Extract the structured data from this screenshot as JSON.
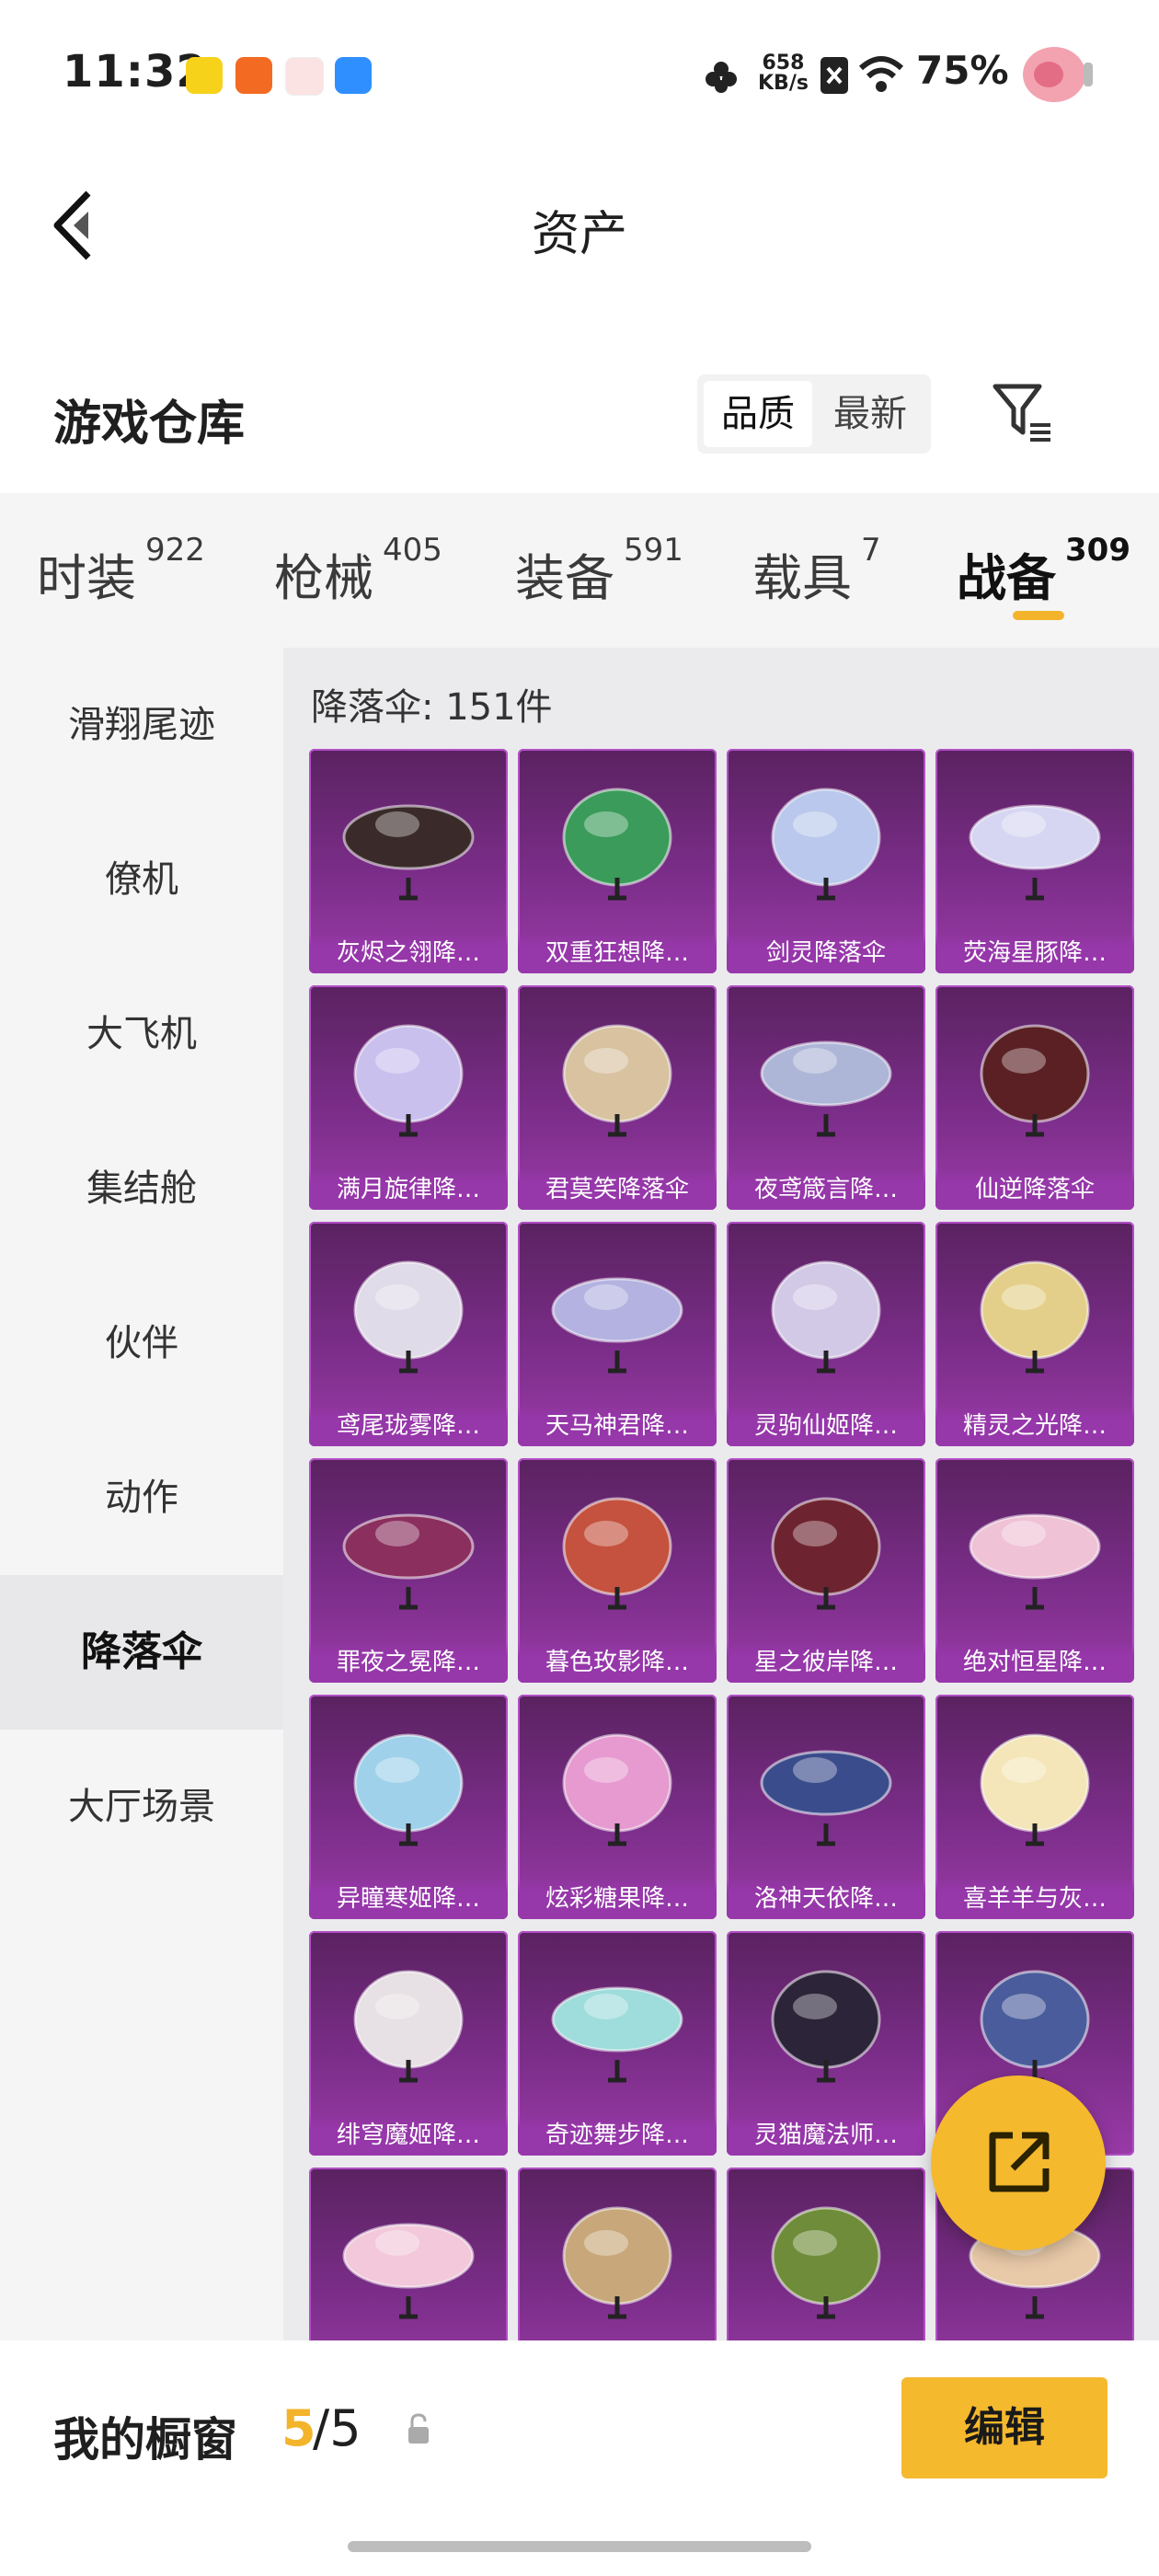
{
  "status_bar": {
    "time": "11:32",
    "net_speed_value": "658",
    "net_speed_unit": "KB/s",
    "battery": "75%"
  },
  "header": {
    "title": "资产"
  },
  "warehouse": {
    "title": "游戏仓库",
    "sort_options": [
      "品质",
      "最新"
    ],
    "sort_selected": "品质"
  },
  "tabs": [
    {
      "label": "时装",
      "count": "922"
    },
    {
      "label": "枪械",
      "count": "405"
    },
    {
      "label": "装备",
      "count": "591"
    },
    {
      "label": "载具",
      "count": "7"
    },
    {
      "label": "战备",
      "count": "309",
      "active": true
    }
  ],
  "sidebar": {
    "items": [
      "滑翔尾迹",
      "僚机",
      "大飞机",
      "集结舱",
      "伙伴",
      "动作",
      "降落伞",
      "大厅场景"
    ],
    "active": "降落伞"
  },
  "grid": {
    "count_label": "降落伞: 151件",
    "items": [
      {
        "label": "灰烬之翎降…",
        "color": "#3a2a2a"
      },
      {
        "label": "双重狂想降…",
        "color": "#3b9b5a"
      },
      {
        "label": "剑灵降落伞",
        "color": "#b9c8ec"
      },
      {
        "label": "荧海星豚降…",
        "color": "#d7d6f2"
      },
      {
        "label": "满月旋律降…",
        "color": "#c9c0ee"
      },
      {
        "label": "君莫笑降落伞",
        "color": "#d8c2a0"
      },
      {
        "label": "夜鸢箴言降…",
        "color": "#aeb6d8"
      },
      {
        "label": "仙逆降落伞",
        "color": "#5a2024"
      },
      {
        "label": "鸢尾珑雾降…",
        "color": "#e0dbe8"
      },
      {
        "label": "天马神君降…",
        "color": "#b3b2e0"
      },
      {
        "label": "灵驹仙姬降…",
        "color": "#d2c9e6"
      },
      {
        "label": "精灵之光降…",
        "color": "#e4cf8a"
      },
      {
        "label": "罪夜之冕降…",
        "color": "#8a2f5e"
      },
      {
        "label": "暮色玫影降…",
        "color": "#c4523e"
      },
      {
        "label": "星之彼岸降…",
        "color": "#6e2430"
      },
      {
        "label": "绝对恒星降…",
        "color": "#f0c2d6"
      },
      {
        "label": "异瞳寒姬降…",
        "color": "#9fd2ea"
      },
      {
        "label": "炫彩糖果降…",
        "color": "#e69ad0"
      },
      {
        "label": "洛神天依降…",
        "color": "#3b4c8c"
      },
      {
        "label": "喜羊羊与灰…",
        "color": "#f4e6b8"
      },
      {
        "label": "绯穹魔姬降…",
        "color": "#e7e0e4"
      },
      {
        "label": "奇迹舞步降…",
        "color": "#9fdcdc"
      },
      {
        "label": "灵猫魔法师…",
        "color": "#2c2438"
      },
      {
        "label": "",
        "color": "#4a5c9c"
      },
      {
        "label": "",
        "color": "#f2c8da"
      },
      {
        "label": "",
        "color": "#c8a87a"
      },
      {
        "label": "",
        "color": "#6f8c3a"
      },
      {
        "label": "",
        "color": "#e8c9a8"
      }
    ]
  },
  "showcase": {
    "title": "我的橱窗",
    "used": "5",
    "separator_total": "/5",
    "edit_label": "编辑"
  },
  "icons": [
    "back-arrow-icon",
    "filter-icon",
    "share-icon",
    "lock-icon",
    "wifi-icon",
    "battery-icon"
  ]
}
